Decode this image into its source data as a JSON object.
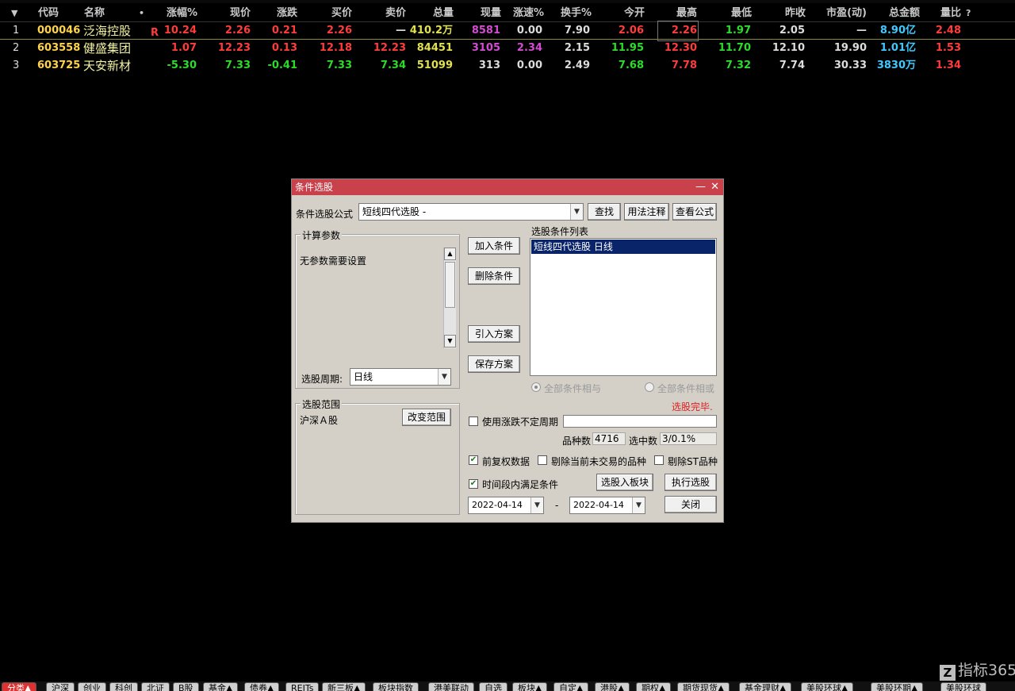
{
  "table": {
    "columns": [
      "代码",
      "名称",
      "•",
      "涨幅%",
      "现价",
      "涨跌",
      "买价",
      "卖价",
      "总量",
      "现量",
      "涨速%",
      "换手%",
      "今开",
      "最高",
      "最低",
      "昨收",
      "市盈(动)",
      "总金额",
      "量比",
      "?"
    ],
    "rows": [
      {
        "idx": "1",
        "code": "000046",
        "name": "泛海控股",
        "badge": "R",
        "chg_pct": "10.24",
        "price": "2.26",
        "chg": "0.21",
        "bid": "2.26",
        "ask": "—",
        "vol": "410.2",
        "vol_unit": "万",
        "cur_vol": "8581",
        "speed": "0.00",
        "turnover": "7.90",
        "open": "2.06",
        "high": "2.26",
        "low": "1.97",
        "prev_close": "2.05",
        "pe": "—",
        "amount": "8.90",
        "amount_unit": "亿",
        "vol_ratio": "2.48"
      },
      {
        "idx": "2",
        "code": "603558",
        "name": "健盛集团",
        "badge": "",
        "chg_pct": "1.07",
        "price": "12.23",
        "chg": "0.13",
        "bid": "12.18",
        "ask": "12.23",
        "vol": "84451",
        "vol_unit": "",
        "cur_vol": "3105",
        "speed": "2.34",
        "turnover": "2.15",
        "open": "11.95",
        "high": "12.30",
        "low": "11.70",
        "prev_close": "12.10",
        "pe": "19.90",
        "amount": "1.01",
        "amount_unit": "亿",
        "vol_ratio": "1.53"
      },
      {
        "idx": "3",
        "code": "603725",
        "name": "天安新材",
        "badge": "",
        "chg_pct": "-5.30",
        "price": "7.33",
        "chg": "-0.41",
        "bid": "7.33",
        "ask": "7.34",
        "vol": "51099",
        "vol_unit": "",
        "cur_vol": "313",
        "speed": "0.00",
        "turnover": "2.49",
        "open": "7.68",
        "high": "7.78",
        "low": "7.32",
        "prev_close": "7.74",
        "pe": "30.33",
        "amount": "3830",
        "amount_unit": "万",
        "vol_ratio": "1.34"
      }
    ]
  },
  "dialog": {
    "title": "条件选股",
    "minimize": "—",
    "close": "✕",
    "formula_label": "条件选股公式",
    "formula_value": "短线四代选股 -",
    "btn_find": "查找",
    "btn_usage": "用法注释",
    "btn_view": "查看公式",
    "calc_params_title": "计算参数",
    "calc_params_text": "无参数需要设置",
    "period_label": "选股周期:",
    "period_value": "日线",
    "range_title": "选股范围",
    "range_value": "沪深Ａ股",
    "btn_change_range": "改变范围",
    "btn_add": "加入条件",
    "btn_delete": "删除条件",
    "btn_import": "引入方案",
    "btn_save": "保存方案",
    "list_title": "选股条件列表",
    "list_items": [
      "短线四代选股  日线"
    ],
    "radio_and": "全部条件相与",
    "radio_or": "全部条件相或",
    "status": "选股完毕.",
    "chk_period": "使用涨跌不定周期",
    "count_label": "品种数",
    "count_value": "4716",
    "selected_label": "选中数",
    "selected_value": "3/0.1%",
    "chk_adjust": "前复权数据",
    "chk_exclude_untraded": "剔除当前未交易的品种",
    "chk_exclude_st": "剔除ST品种",
    "chk_time_range": "时间段内满足条件",
    "btn_to_block": "选股入板块",
    "btn_run": "执行选股",
    "btn_close": "关闭",
    "date_from": "2022-04-14",
    "date_sep": "-",
    "date_to": "2022-04-14"
  },
  "tabs": [
    "分类▲",
    "沪深",
    "创业",
    "科创",
    "北证",
    "B股",
    "基金▲",
    "债券▲",
    "REITs",
    "新三板▲",
    "板块指数",
    "港美联动",
    "自选",
    "板块▲",
    "自定▲",
    "港股▲",
    "期权▲",
    "期货现货▲",
    "基金理财▲",
    "美股环球▲",
    "美股环期▲",
    "美股环球"
  ],
  "watermark": {
    "mark": "Z",
    "text": "指标365"
  }
}
